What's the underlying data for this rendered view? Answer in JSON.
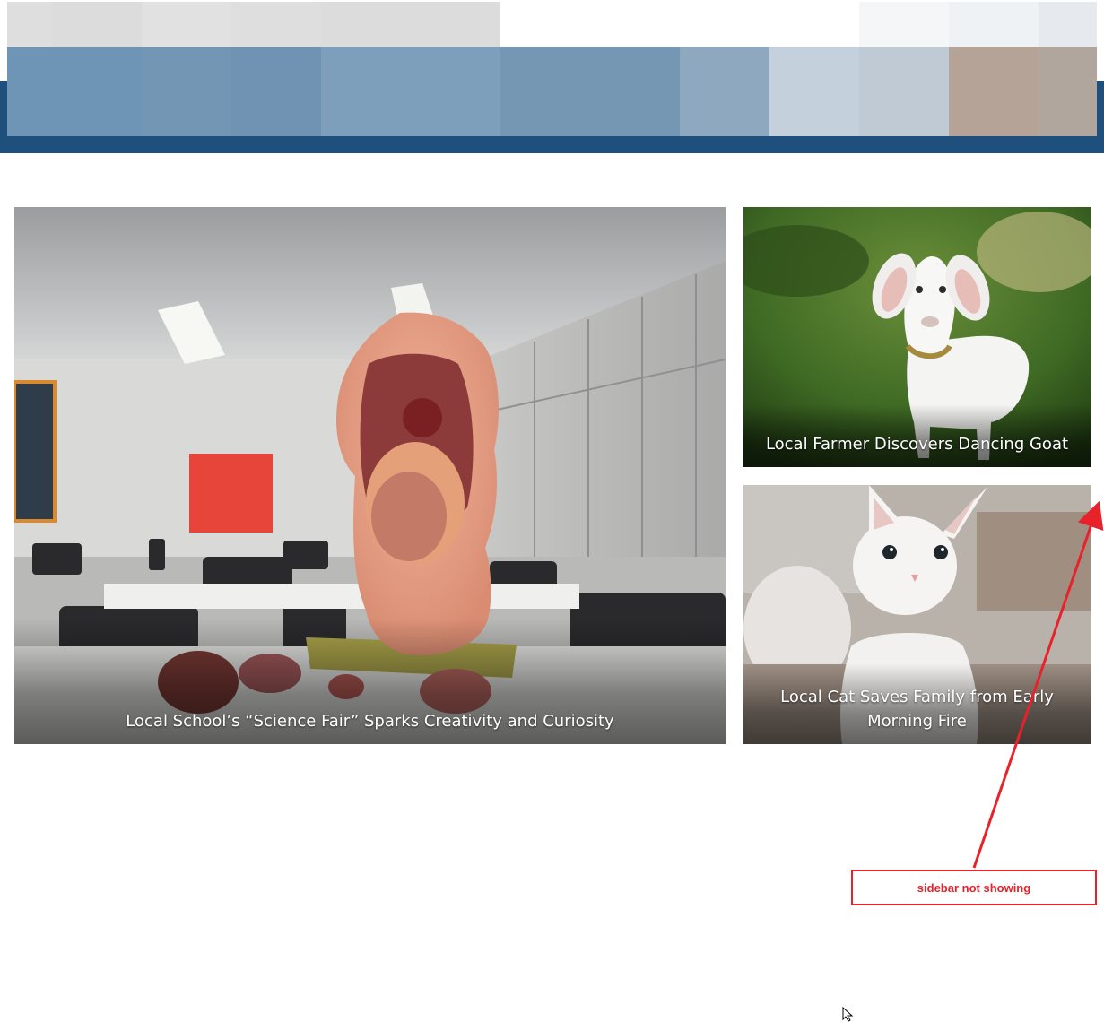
{
  "header": {
    "band_color": "#1f4f7c",
    "mosaic_colors": [
      "#dcdcdc",
      "#e1e1e1",
      "#dedede",
      "#f4f6f8",
      "#eef2f5",
      "#e6eaee",
      "#6f95b6",
      "#7396b5",
      "#7e9fbc",
      "#7899b6",
      "#7597b3",
      "#8ea8c0",
      "#c4d0dc",
      "#bfcad4",
      "#b5a398",
      "#b1a69e"
    ]
  },
  "featured": {
    "main": {
      "title": "Local School’s “Science Fair” Sparks Creativity and Curiosity",
      "image_icon": "anatomy-model-photo"
    },
    "goat": {
      "title": "Local Farmer Discovers Dancing Goat",
      "image_icon": "goat-photo"
    },
    "cat": {
      "title": "Local Cat Saves Family from Early Morning Fire",
      "image_icon": "cat-photo"
    }
  },
  "annotation": {
    "label": "sidebar not showing",
    "color": "#e8222b"
  }
}
